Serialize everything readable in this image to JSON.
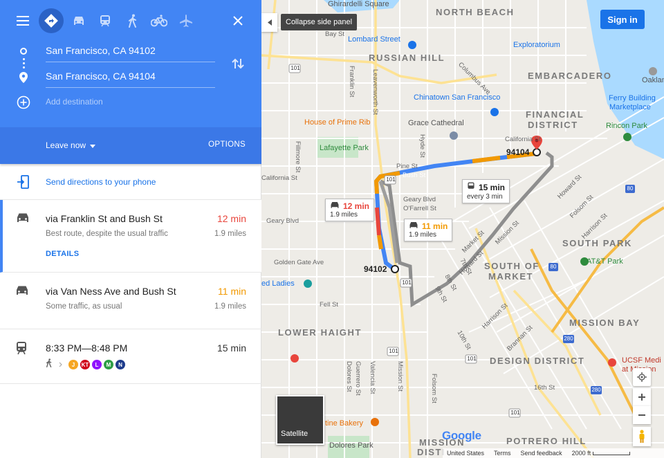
{
  "panel": {
    "menu_icon": "hamburger-menu-icon",
    "modes": [
      {
        "name": "best-travel-mode",
        "icon": "directions-icon",
        "active": true
      },
      {
        "name": "driving",
        "icon": "car-icon"
      },
      {
        "name": "transit",
        "icon": "train-icon"
      },
      {
        "name": "walking",
        "icon": "walk-icon"
      },
      {
        "name": "cycling",
        "icon": "bike-icon"
      },
      {
        "name": "flights",
        "icon": "plane-icon"
      }
    ],
    "close_icon": "close-icon",
    "origin": "San Francisco, CA 94102",
    "destination": "San Francisco, CA 94104",
    "add_destination": "Add destination",
    "leave_now": "Leave now",
    "options": "OPTIONS",
    "send_directions": "Send directions to your phone",
    "routes": [
      {
        "title": "via Franklin St and Bush St",
        "time": "12 min",
        "time_color": "#e8453c",
        "subtitle": "Best route, despite the usual traffic",
        "distance": "1.9 miles",
        "details": "DETAILS"
      },
      {
        "title": "via Van Ness Ave and Bush St",
        "time": "11 min",
        "time_color": "#f29900",
        "subtitle": "Some traffic, as usual",
        "distance": "1.9 miles"
      },
      {
        "title": "8:33 PM—8:48 PM",
        "time": "15 min",
        "time_color": "#333333"
      }
    ],
    "transit_lines": [
      {
        "label": "J",
        "color": "#f5a623"
      },
      {
        "label": "KT",
        "color": "#d0021b"
      },
      {
        "label": "L",
        "color": "#9013fe"
      },
      {
        "label": "M",
        "color": "#2e9e46"
      },
      {
        "label": "N",
        "color": "#1e3c8c"
      }
    ]
  },
  "map": {
    "collapse_tooltip": "Collapse side panel",
    "sign_in": "Sign in",
    "satellite": "Satellite",
    "labels": {
      "north_beach": "NORTH BEACH",
      "russian_hill": "RUSSIAN HILL",
      "embarcadero": "EMBARCADERO",
      "financial_district": "FINANCIAL",
      "financial_district_2": "DISTRICT",
      "south_park": "SOUTH PARK",
      "south_of_market": "SOUTH OF",
      "south_of_market_2": "MARKET",
      "mission_bay": "MISSION BAY",
      "lower_haight": "LOWER HAIGHT",
      "design_district": "DESIGN DISTRICT",
      "potrero_hill": "POTRERO HILL",
      "mission": "MISSION",
      "mission_2": "DISTI",
      "ghirardelli": "Ghirardelli Square",
      "lombard": "Lombard Street",
      "exploratorium": "Exploratorium",
      "chinatown": "Chinatown San Francisco",
      "house_prime_rib": "House of Prime Rib",
      "grace": "Grace Cathedral",
      "lafayette": "Lafayette Park",
      "ferry": "Ferry Building",
      "ferry_2": "Marketplace",
      "rincon": "Rincon Park",
      "att": "AT&T Park",
      "ucsf": "UCSF Medi",
      "ucsf_2": "at Mission",
      "ladies": "ed Ladies",
      "tartine": "tine Bakery",
      "dolores": "Dolores Park",
      "oaklan": "Oaklan",
      "bay_st": "Bay St",
      "california_st": "California St",
      "pine_st": "Pine St",
      "bush_st": "Bush St",
      "geary_blvd": "Geary Blvd",
      "geary_blvd_2": "Geary Blvd",
      "ofarrell": "O'Farrell St",
      "golden_gate": "Golden Gate Ave",
      "fell_st": "Fell St",
      "franklin_st": "Franklin St",
      "leavenworth": "Leavenworth St",
      "fillmore": "Fillmore St",
      "hyde": "Hyde St",
      "columbus": "Columbus Ave",
      "mission_st": "Mission St",
      "market_st": "Market St",
      "howard_st": "Howard St",
      "folsom_st": "Folsom St",
      "dolores_st": "Dolores St",
      "valencia": "Valencia St",
      "guerrero": "Guerrero St",
      "harrison": "Harrison St",
      "brannan": "Brannan St",
      "sixteenth": "16th St",
      "seventh": "7th St",
      "eighth": "8th St",
      "ninth": "9th St",
      "tenth": "10th St",
      "california_st_2": "California St",
      "h101a": "101",
      "h101b": "101",
      "h101c": "101",
      "h101d": "101",
      "h101e": "101",
      "h101f": "101",
      "i80a": "80",
      "i80b": "80",
      "i280a": "280",
      "i280b": "280"
    },
    "origin_label": "94102",
    "dest_label": "94104",
    "callouts": [
      {
        "time": "12 min",
        "sub": "1.9 miles",
        "color": "#e8453c"
      },
      {
        "time": "11 min",
        "sub": "1.9 miles",
        "color": "#f29900"
      },
      {
        "time": "15 min",
        "sub": "every 3 min",
        "color": "#222222"
      }
    ],
    "footer": {
      "country": "United States",
      "terms": "Terms",
      "feedback": "Send feedback",
      "scale": "2000 ft"
    },
    "logo": "Google"
  }
}
